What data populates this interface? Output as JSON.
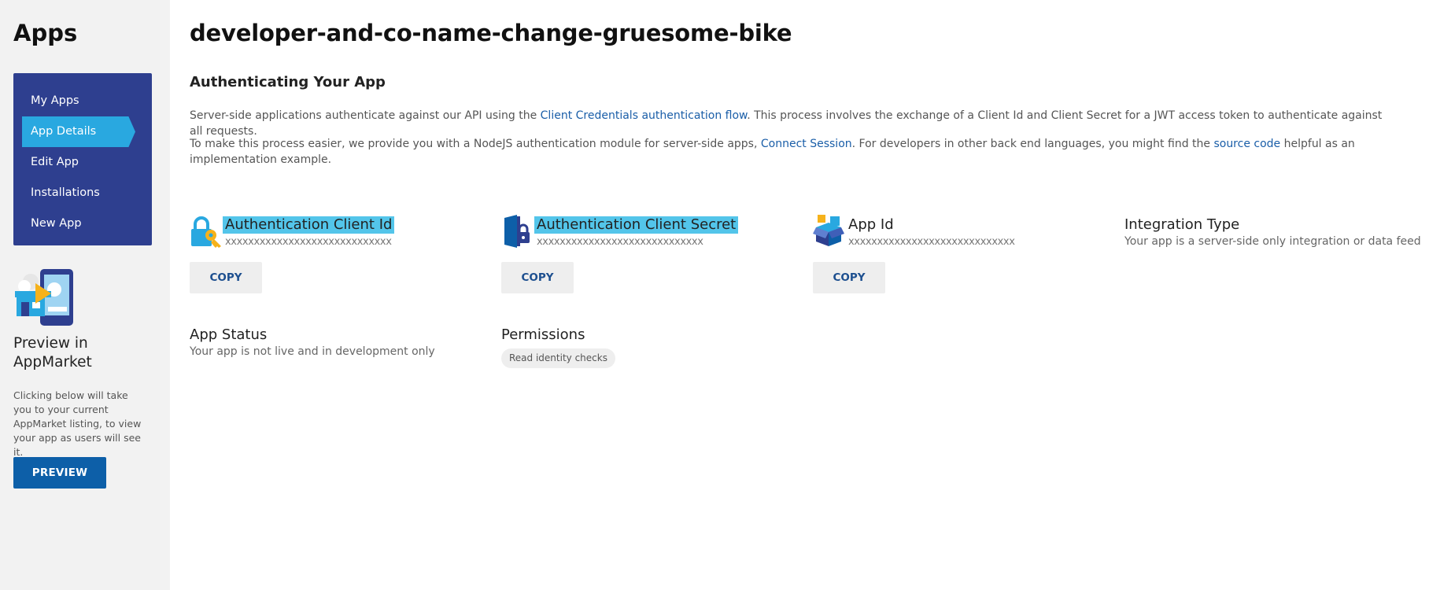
{
  "sidebar": {
    "title": "Apps",
    "nav": [
      {
        "label": "My Apps",
        "active": false
      },
      {
        "label": "App Details",
        "active": true
      },
      {
        "label": "Edit App",
        "active": false
      },
      {
        "label": "Installations",
        "active": false
      },
      {
        "label": "New App",
        "active": false
      }
    ],
    "preview": {
      "title": "Preview in AppMarket",
      "description": "Clicking below will take you to your current AppMarket listing, to view your app as users will see it.",
      "button_label": "PREVIEW"
    }
  },
  "main": {
    "title": "developer-and-co-name-change-gruesome-bike",
    "section_title": "Authenticating Your App",
    "para1": {
      "before": "Server-side applications authenticate against our API using the ",
      "link": "Client Credentials authentication flow",
      "after": ". This process involves the exchange of a Client Id and Client Secret for a JWT access token to authenticate against all requests."
    },
    "para2": {
      "before": "To make this process easier, we provide you with a NodeJS authentication module for server-side apps, ",
      "link1": "Connect Session",
      "middle": ". For developers in other back end languages, you might find the ",
      "link2": "source code",
      "after": " helpful as an implementation example."
    },
    "credentials": {
      "client_id": {
        "label": "Authentication Client Id",
        "value": "xxxxxxxxxxxxxxxxxxxxxxxxxxxxx",
        "icon": "lock-key-icon",
        "copy_label": "COPY"
      },
      "client_secret": {
        "label": "Authentication Client Secret",
        "value": "xxxxxxxxxxxxxxxxxxxxxxxxxxxxx",
        "icon": "locked-door-icon",
        "copy_label": "COPY"
      },
      "app_id": {
        "label": "App Id",
        "value": "xxxxxxxxxxxxxxxxxxxxxxxxxxxxx",
        "icon": "app-box-icon",
        "copy_label": "COPY"
      }
    },
    "integration_type": {
      "label": "Integration Type",
      "value": "Your app is a server-side only integration or data feed"
    },
    "app_status": {
      "label": "App Status",
      "value": "Your app is not live and in development only"
    },
    "permissions": {
      "label": "Permissions",
      "badges": [
        "Read identity checks"
      ]
    }
  },
  "colors": {
    "nav_bg": "#2e3f8f",
    "nav_active": "#29a8e0",
    "highlight": "#53c5ea",
    "primary_button": "#0d5fa8",
    "link": "#1a5ea8"
  }
}
